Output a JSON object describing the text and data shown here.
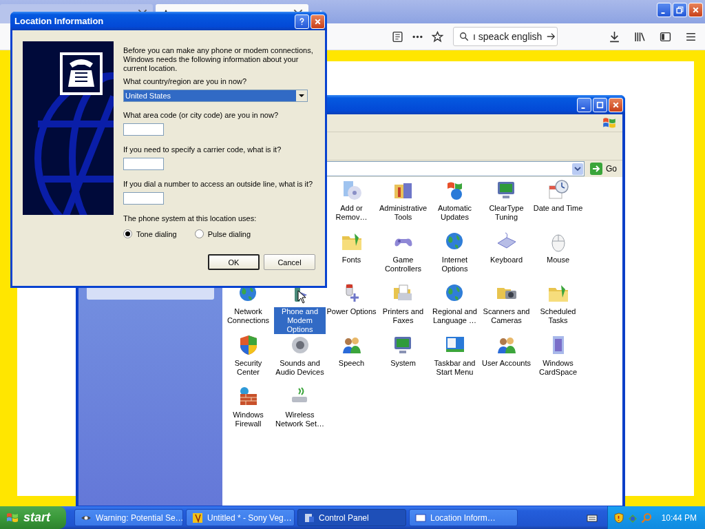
{
  "browser": {
    "search_field": {
      "value": "ı speack english"
    }
  },
  "control_panel": {
    "go_button": "Go",
    "rows": [
      [
        {
          "label": "Add or Remov…",
          "selected": false
        },
        {
          "label": "Administrative Tools",
          "selected": false
        },
        {
          "label": "Automatic Updates",
          "selected": false
        },
        {
          "label": "ClearType Tuning",
          "selected": false
        },
        {
          "label": "Date and Time",
          "selected": false
        }
      ],
      [
        {
          "label": "Fonts",
          "selected": false
        },
        {
          "label": "Game Controllers",
          "selected": false
        },
        {
          "label": "Internet Options",
          "selected": false
        },
        {
          "label": "Keyboard",
          "selected": false
        },
        {
          "label": "Mouse",
          "selected": false
        }
      ],
      [
        {
          "label": "Network Connections",
          "selected": false
        },
        {
          "label": "Phone and Modem Options",
          "selected": true
        },
        {
          "label": "Power Options",
          "selected": false
        },
        {
          "label": "Printers and Faxes",
          "selected": false
        },
        {
          "label": "Regional and Language …",
          "selected": false
        },
        {
          "label": "Scanners and Cameras",
          "selected": false
        },
        {
          "label": "Scheduled Tasks",
          "selected": false
        }
      ],
      [
        {
          "label": "Security Center",
          "selected": false
        },
        {
          "label": "Sounds and Audio Devices",
          "selected": false
        },
        {
          "label": "Speech",
          "selected": false
        },
        {
          "label": "System",
          "selected": false
        },
        {
          "label": "Taskbar and Start Menu",
          "selected": false
        },
        {
          "label": "User Accounts",
          "selected": false
        },
        {
          "label": "Windows CardSpace",
          "selected": false
        }
      ],
      [
        {
          "label": "Windows Firewall",
          "selected": false
        },
        {
          "label": "Wireless Network Set…",
          "selected": false
        }
      ]
    ]
  },
  "dialog": {
    "title": "Location Information",
    "intro": "Before you can make any phone or modem connections, Windows needs the following information about your current location.",
    "country_label": "What country/region are you in now?",
    "country": {
      "value": "United States"
    },
    "area_code_label": "What area code (or city code) are you in now?",
    "carrier_label": "If you need to specify a carrier code, what is it?",
    "outside_line_label": "If you dial a number to access an outside line, what is it?",
    "phone_system_label": "The phone system at this location uses:",
    "dialing": [
      {
        "label": "Tone dialing",
        "selected": true
      },
      {
        "label": "Pulse dialing",
        "selected": false
      }
    ],
    "buttons": [
      {
        "label": "OK",
        "default": true
      },
      {
        "label": "Cancel",
        "default": false
      }
    ]
  },
  "taskbar": {
    "start": "start",
    "tasks": [
      {
        "label": "Warning: Potential Se…",
        "selected": false
      },
      {
        "label": "Untitled * - Sony Veg…",
        "selected": false
      },
      {
        "label": "Control Panel",
        "selected": true
      },
      {
        "label": "Location Inform…",
        "selected": false
      }
    ],
    "clock": "10:44 PM"
  }
}
